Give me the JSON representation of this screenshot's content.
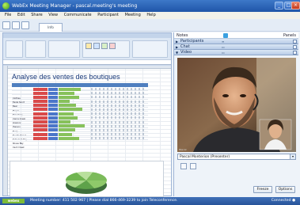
{
  "window": {
    "title": "WebEx Meeting Manager - pascal.meeting's meeting",
    "minimize": "_",
    "maximize": "□",
    "close": "×"
  },
  "menu": {
    "items": [
      "File",
      "Edit",
      "Share",
      "View",
      "Communicate",
      "Participant",
      "Meeting",
      "Help"
    ]
  },
  "toolbar": {
    "tab_label": "Info"
  },
  "sheet": {
    "title": "Analyse des ventes des boutiques",
    "rows": [
      {
        "name": "Clothes",
        "bar": 28
      },
      {
        "name": "Eagle Sport",
        "bar": 20
      },
      {
        "name": "Bear",
        "bar": 26
      },
      {
        "name": "Mayer",
        "bar": 14
      },
      {
        "name": "Broadway",
        "bar": 22
      },
      {
        "name": "Cierra Creek",
        "bar": 30
      },
      {
        "name": "Gregory",
        "bar": 19
      },
      {
        "name": "Hanson",
        "bar": 24
      },
      {
        "name": "Flarp",
        "bar": 15
      },
      {
        "name": "Flouth Street",
        "bar": 33
      },
      {
        "name": "Tableland Bay",
        "bar": 21
      },
      {
        "name": "Rouse Bay",
        "bar": 17
      },
      {
        "name": "Cecil Creek",
        "bar": 26
      }
    ]
  },
  "right_panel": {
    "notes_label": "Notes",
    "panels_label": "Panels",
    "sections": [
      {
        "label": "Participants"
      },
      {
        "label": "Chat"
      },
      {
        "label": "Video"
      }
    ],
    "presenter": "Pascal Monterion (Presenter)",
    "freeze_label": "Freeze",
    "options_label": "Options",
    "video_caption": "Pascal"
  },
  "status": {
    "brand": "webex",
    "message": "Meeting number: 411 502 967  |  Please dial 866-469-3239 to join Teleconference.",
    "connection": "Connected ●"
  },
  "colors": {
    "titlebar": "#2a5fb3",
    "accent_green": "#87c15b",
    "bar_red": "#d94a4a",
    "bar_blue": "#4b76c9"
  }
}
